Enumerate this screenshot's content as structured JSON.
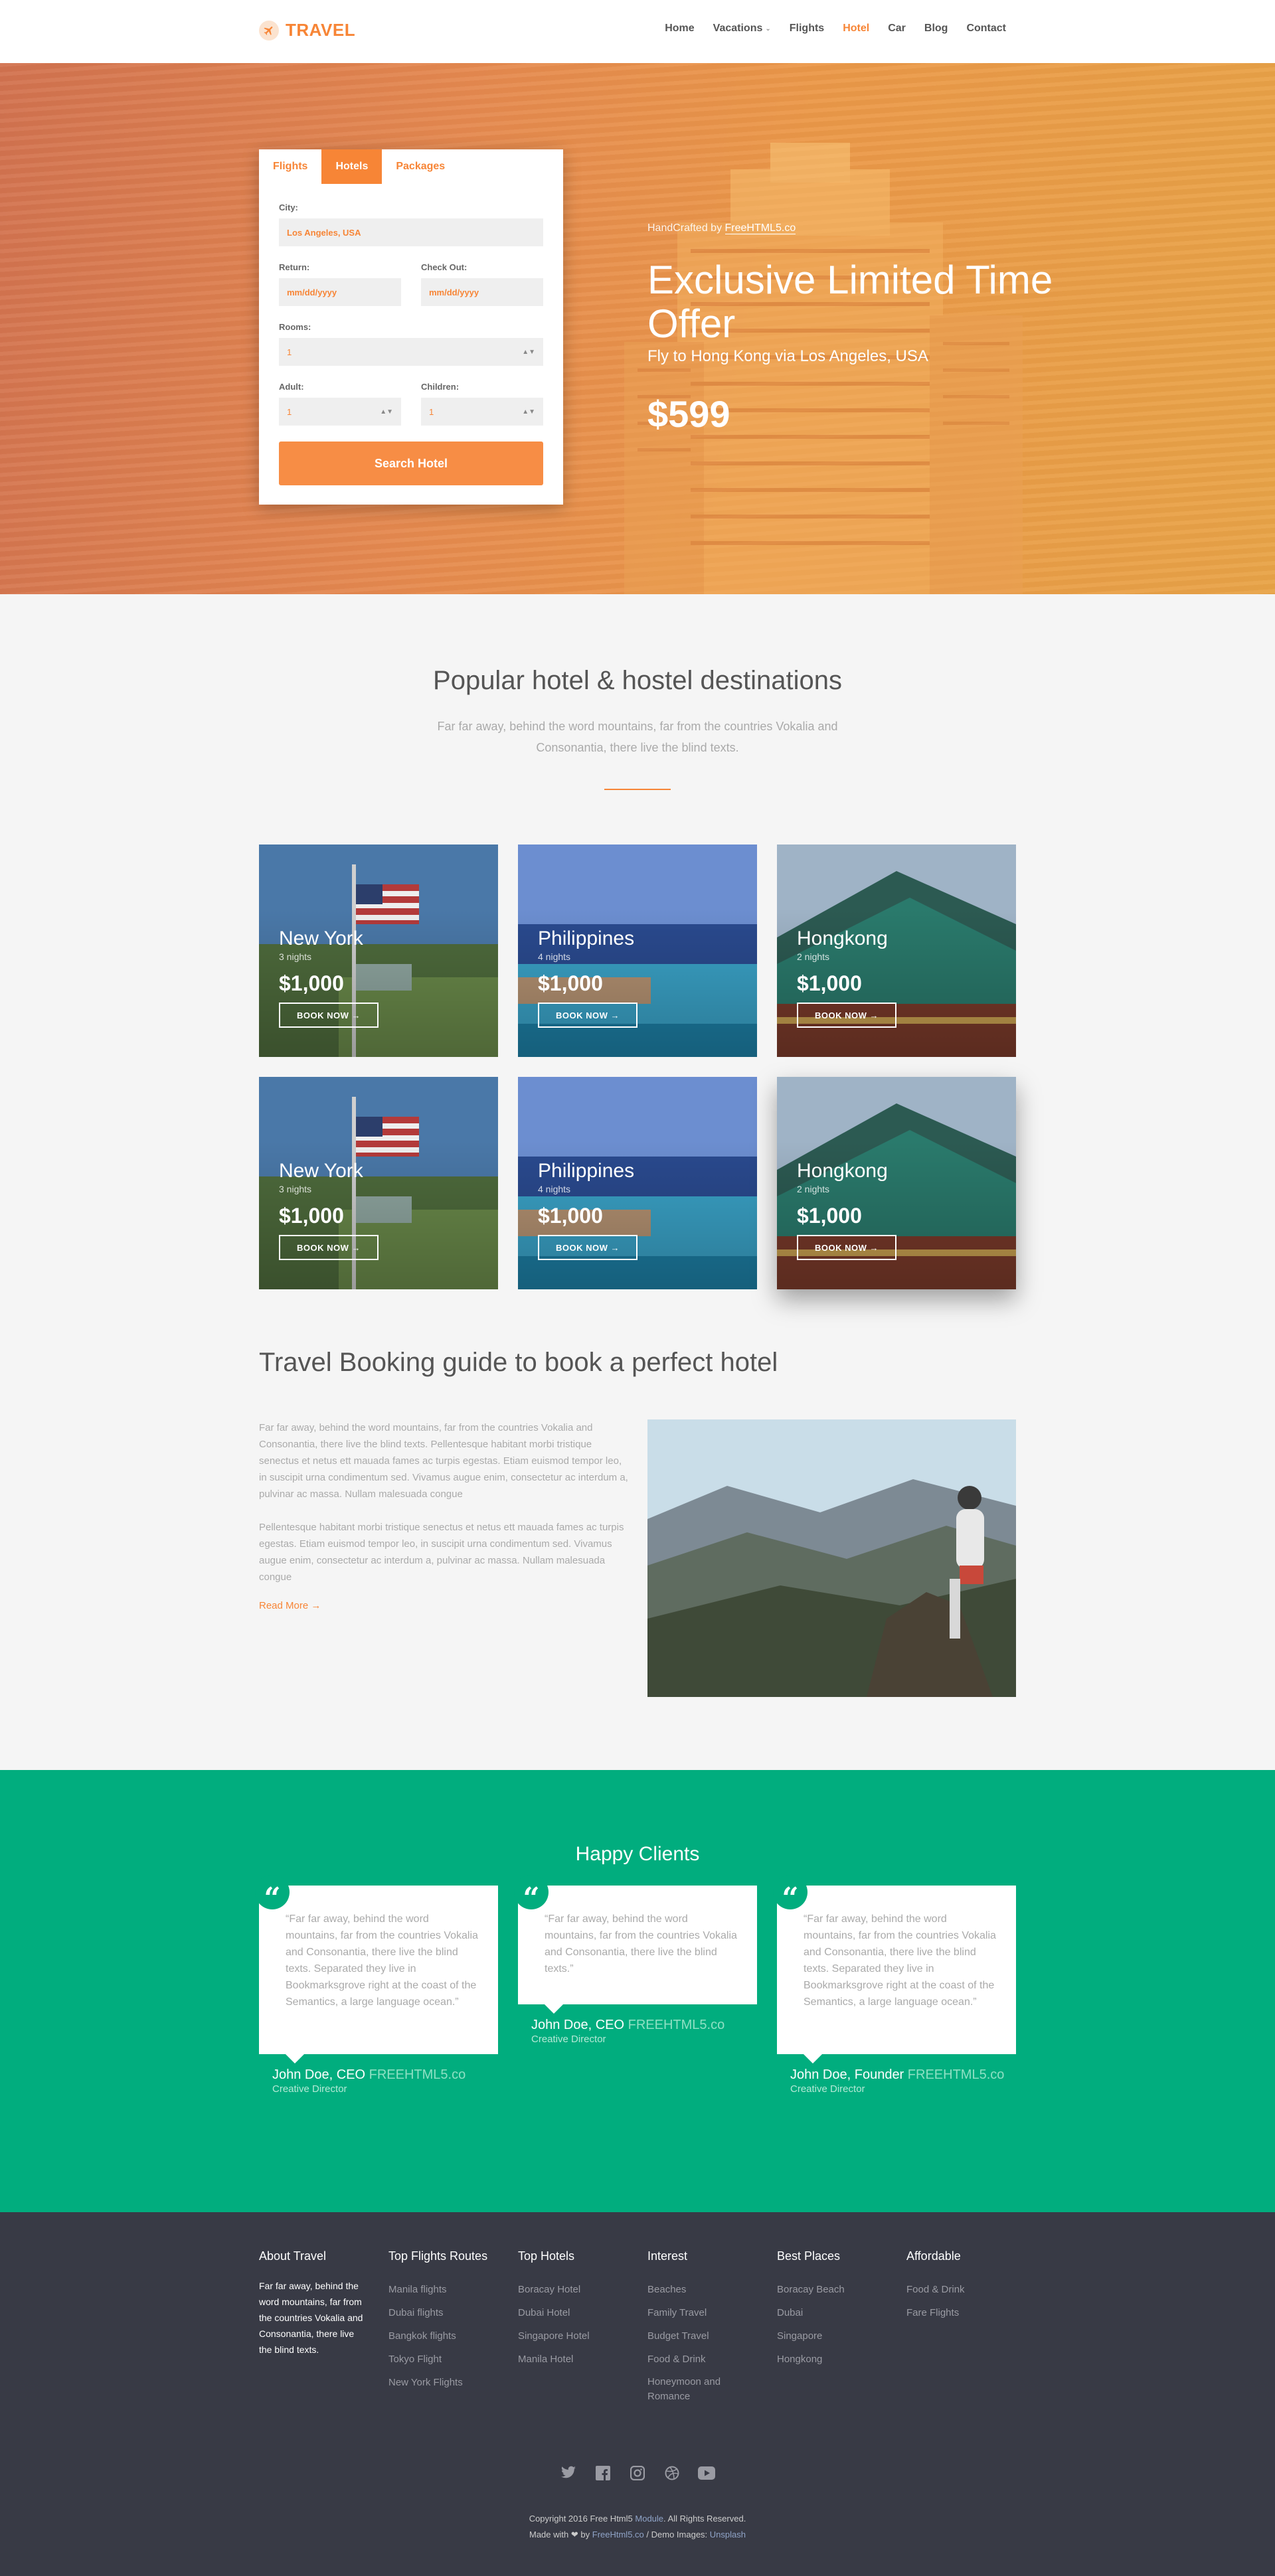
{
  "header": {
    "logo_text": "TRAVEL",
    "nav": [
      {
        "label": "Home",
        "active": false
      },
      {
        "label": "Vacations",
        "active": false
      },
      {
        "label": "Flights",
        "active": false
      },
      {
        "label": "Hotel",
        "active": true
      },
      {
        "label": "Car",
        "active": false
      },
      {
        "label": "Blog",
        "active": false
      },
      {
        "label": "Contact",
        "active": false
      }
    ]
  },
  "search": {
    "tabs": [
      "Flights",
      "Hotels",
      "Packages"
    ],
    "active_tab": "Hotels",
    "city_label": "City:",
    "city_value": "Los Angeles, USA",
    "return_label": "Return:",
    "return_placeholder": "mm/dd/yyyy",
    "checkout_label": "Check Out:",
    "checkout_placeholder": "mm/dd/yyyy",
    "rooms_label": "Rooms:",
    "rooms_value": "1",
    "adult_label": "Adult:",
    "adult_value": "1",
    "children_label": "Children:",
    "children_value": "1",
    "submit_label": "Search Hotel"
  },
  "hero": {
    "handcrafted_prefix": "HandCrafted by",
    "handcrafted_link": "FreeHTML5.co",
    "title": "Exclusive Limited Time Offer",
    "subtitle": "Fly to Hong Kong via Los Angeles, USA",
    "price": "$599"
  },
  "popular": {
    "title": "Popular hotel & hostel destinations",
    "subtitle": "Far far away, behind the word mountains, far from the countries Vokalia and Consonantia, there live the blind texts.",
    "cards": [
      {
        "city": "New York",
        "nights": "3 nights",
        "price": "$1,000",
        "button": "BOOK NOW"
      },
      {
        "city": "Philippines",
        "nights": "4 nights",
        "price": "$1,000",
        "button": "BOOK NOW"
      },
      {
        "city": "Hongkong",
        "nights": "2 nights",
        "price": "$1,000",
        "button": "BOOK NOW"
      },
      {
        "city": "New York",
        "nights": "3 nights",
        "price": "$1,000",
        "button": "BOOK NOW"
      },
      {
        "city": "Philippines",
        "nights": "4 nights",
        "price": "$1,000",
        "button": "BOOK NOW"
      },
      {
        "city": "Hongkong",
        "nights": "2 nights",
        "price": "$1,000",
        "button": "BOOK NOW"
      }
    ]
  },
  "guide": {
    "title": "Travel Booking guide to book a perfect hotel",
    "paragraph1": "Far far away, behind the word mountains, far from the countries Vokalia and Consonantia, there live the blind texts. Pellentesque habitant morbi tristique senectus et netus ett mauada fames ac turpis egestas. Etiam euismod tempor leo, in suscipit urna condimentum sed. Vivamus augue enim, consectetur ac interdum a, pulvinar ac massa. Nullam malesuada congue",
    "paragraph2": "Pellentesque habitant morbi tristique senectus et netus ett mauada fames ac turpis egestas. Etiam euismod tempor leo, in suscipit urna condimentum sed. Vivamus augue enim, consectetur ac interdum a, pulvinar ac massa. Nullam malesuada congue",
    "read_more": "Read More"
  },
  "clients": {
    "title": "Happy Clients",
    "testimonials": [
      {
        "quote": "“Far far away, behind the word mountains, far from the countries Vokalia and Consonantia, there live the blind texts. Separated they live in Bookmarksgrove right at the coast of the Semantics, a large language ocean.”",
        "name": "John Doe, CEO",
        "brand": "FREEHTML5.co",
        "role": "Creative Director"
      },
      {
        "quote": "“Far far away, behind the word mountains, far from the countries Vokalia and Consonantia, there live the blind texts.”",
        "name": "John Doe, CEO",
        "brand": "FREEHTML5.co",
        "role": "Creative Director"
      },
      {
        "quote": "“Far far away, behind the word mountains, far from the countries Vokalia and Consonantia, there live the blind texts. Separated they live in Bookmarksgrove right at the coast of the Semantics, a large language ocean.”",
        "name": "John Doe, Founder",
        "brand": "FREEHTML5.co",
        "role": "Creative Director"
      }
    ]
  },
  "footer": {
    "about_title": "About Travel",
    "about_text": "Far far away, behind the word mountains, far from the countries Vokalia and Consonantia, there live the blind texts.",
    "columns": [
      {
        "title": "Top Flights Routes",
        "items": [
          "Manila flights",
          "Dubai flights",
          "Bangkok flights",
          "Tokyo Flight",
          "New York Flights"
        ]
      },
      {
        "title": "Top Hotels",
        "items": [
          "Boracay Hotel",
          "Dubai Hotel",
          "Singapore Hotel",
          "Manila Hotel"
        ]
      },
      {
        "title": "Interest",
        "items": [
          "Beaches",
          "Family Travel",
          "Budget Travel",
          "Food & Drink",
          "Honeymoon and Romance"
        ]
      },
      {
        "title": "Best Places",
        "items": [
          "Boracay Beach",
          "Dubai",
          "Singapore",
          "Hongkong"
        ]
      },
      {
        "title": "Affordable",
        "items": [
          "Food & Drink",
          "Fare Flights"
        ]
      }
    ],
    "socials": [
      "twitter-icon",
      "facebook-icon",
      "instagram-icon",
      "dribbble-icon",
      "youtube-icon"
    ],
    "copyright_prefix": "Copyright 2016 Free Html5",
    "copyright_module": "Module",
    "copyright_suffix": ". All Rights Reserved.",
    "made_with": "Made with",
    "made_by": "by",
    "made_by_link": "FreeHtml5.co",
    "demo_images": "/ Demo Images:",
    "unsplash": "Unsplash"
  },
  "colors": {
    "accent": "#f78536",
    "green": "#01ad7e",
    "footer": "#383a45"
  }
}
